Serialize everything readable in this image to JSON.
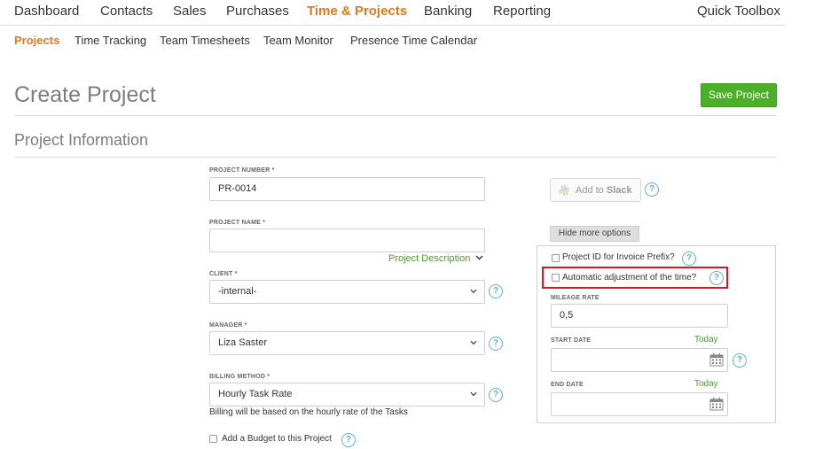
{
  "topnav": {
    "items": [
      "Dashboard",
      "Contacts",
      "Sales",
      "Purchases",
      "Time & Projects",
      "Banking",
      "Reporting"
    ],
    "right": "Quick Toolbox"
  },
  "subnav": {
    "items": [
      "Projects",
      "Time Tracking",
      "Team Timesheets",
      "Team Monitor",
      "Presence Time Calendar"
    ]
  },
  "page": {
    "title": "Create Project",
    "save_label": "Save Project",
    "section_title": "Project Information"
  },
  "form": {
    "project_number": {
      "label": "PROJECT NUMBER *",
      "value": "PR-0014"
    },
    "project_name": {
      "label": "PROJECT NAME *",
      "value": ""
    },
    "description_link": "Project Description",
    "client": {
      "label": "CLIENT *",
      "value": "-internal-"
    },
    "manager": {
      "label": "MANAGER *",
      "value": "Liza Saster"
    },
    "billing": {
      "label": "BILLING METHOD *",
      "value": "Hourly Task Rate",
      "note": "Billing will be based on the hourly rate of the Tasks"
    },
    "budget_label": "Add a Budget to this Project"
  },
  "side": {
    "slack_prefix": "Add to ",
    "slack_brand": "Slack",
    "more_options_label": "Hide more options",
    "prefix_checkbox": "Project ID for Invoice Prefix?",
    "auto_adjust_checkbox": "Automatic adjustment of the time?",
    "mileage": {
      "label": "MILEAGE RATE",
      "value": "0,5"
    },
    "start_date": {
      "label": "START DATE",
      "today": "Today",
      "value": ""
    },
    "end_date": {
      "label": "END DATE",
      "today": "Today",
      "value": ""
    }
  },
  "icons": {
    "help": "?",
    "chevron": "chevron-down-icon",
    "calendar": "calendar-icon",
    "slack": "slack-logo-icon"
  },
  "colors": {
    "accent": "#e07a1f",
    "save": "#4caf28",
    "link": "#49a02a",
    "help": "#5fb0d6",
    "highlight": "#e0141e"
  }
}
